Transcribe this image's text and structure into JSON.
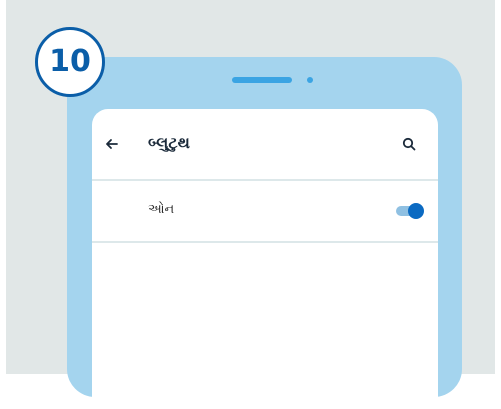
{
  "step": {
    "number": "10"
  },
  "screen": {
    "title": "બ્લુટુથ",
    "back_icon": "arrow-left-icon",
    "search_icon": "search-icon"
  },
  "bluetooth_setting": {
    "label": "ઓન",
    "toggle_state": "on"
  },
  "colors": {
    "background": "#e1e7e7",
    "phone_body": "#a4d4ee",
    "accent": "#0b5ea8",
    "toggle_on": "#0b6ac2"
  }
}
